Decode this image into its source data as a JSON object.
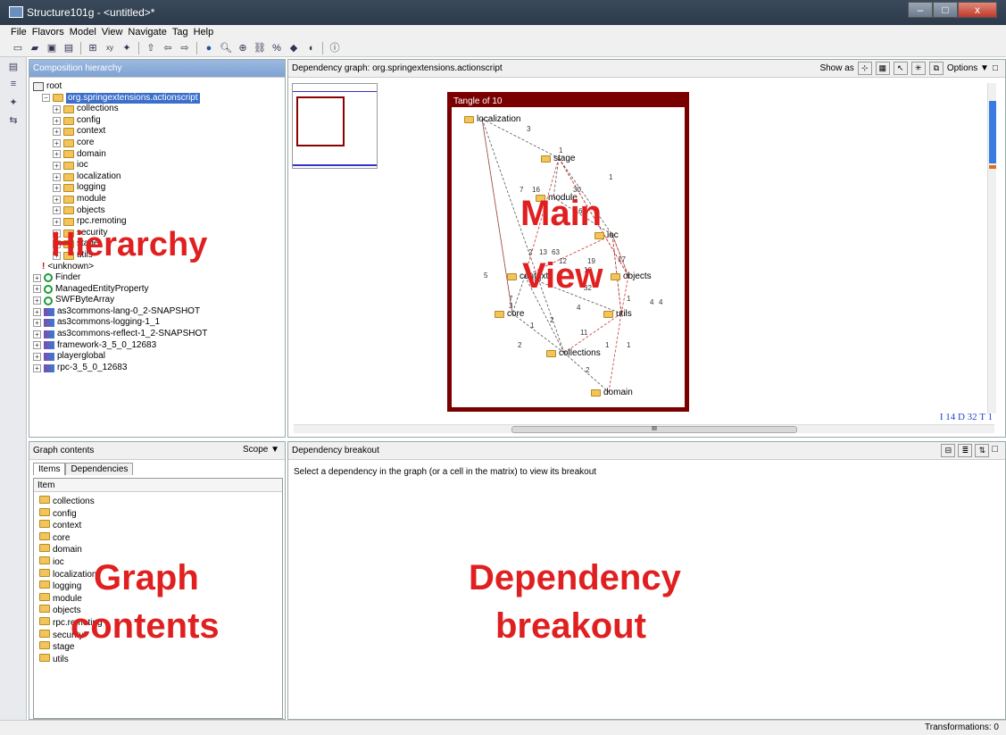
{
  "window": {
    "title": "Structure101g - <untitled>*"
  },
  "menu": [
    "File",
    "Flavors",
    "Model",
    "View",
    "Navigate",
    "Tag",
    "Help"
  ],
  "toolbar_icons": [
    "new-file-icon",
    "open-folder-icon",
    "save-icon",
    "save-as-icon",
    "hierarchy-icon",
    "xy-icon",
    "filter-icon",
    "up-arrow-icon",
    "back-arrow-icon",
    "forward-arrow-icon",
    "dot-icon",
    "zoom-icon",
    "zoom-x-icon",
    "link-icon",
    "percent-icon",
    "tag-icon",
    "bookmark-icon",
    "help-icon"
  ],
  "hierarchy": {
    "title": "Composition hierarchy",
    "items": [
      {
        "label": "root",
        "level": 0,
        "icon": "root"
      },
      {
        "label": "org.springextensions.actionscript",
        "level": 1,
        "icon": "folder",
        "selected": true
      },
      {
        "label": "collections",
        "level": 2,
        "icon": "folder"
      },
      {
        "label": "config",
        "level": 2,
        "icon": "folder"
      },
      {
        "label": "context",
        "level": 2,
        "icon": "folder"
      },
      {
        "label": "core",
        "level": 2,
        "icon": "folder"
      },
      {
        "label": "domain",
        "level": 2,
        "icon": "folder"
      },
      {
        "label": "ioc",
        "level": 2,
        "icon": "folder"
      },
      {
        "label": "localization",
        "level": 2,
        "icon": "folder"
      },
      {
        "label": "logging",
        "level": 2,
        "icon": "folder"
      },
      {
        "label": "module",
        "level": 2,
        "icon": "folder"
      },
      {
        "label": "objects",
        "level": 2,
        "icon": "folder"
      },
      {
        "label": "rpc.remoting",
        "level": 2,
        "icon": "folder"
      },
      {
        "label": "security",
        "level": 2,
        "icon": "folder"
      },
      {
        "label": "stage",
        "level": 2,
        "icon": "folder"
      },
      {
        "label": "utils",
        "level": 2,
        "icon": "folder"
      },
      {
        "label": "<unknown>",
        "level": 1,
        "icon": "unknown"
      },
      {
        "label": "Finder",
        "level": 0,
        "icon": "class"
      },
      {
        "label": "ManagedEntityProperty",
        "level": 0,
        "icon": "class"
      },
      {
        "label": "SWFByteArray",
        "level": 0,
        "icon": "class"
      },
      {
        "label": "as3commons-lang-0_2-SNAPSHOT",
        "level": 0,
        "icon": "jar"
      },
      {
        "label": "as3commons-logging-1_1",
        "level": 0,
        "icon": "jar"
      },
      {
        "label": "as3commons-reflect-1_2-SNAPSHOT",
        "level": 0,
        "icon": "jar"
      },
      {
        "label": "framework-3_5_0_12683",
        "level": 0,
        "icon": "jar"
      },
      {
        "label": "playerglobal",
        "level": 0,
        "icon": "jar"
      },
      {
        "label": "rpc-3_5_0_12683",
        "level": 0,
        "icon": "jar"
      }
    ]
  },
  "main": {
    "title": "Dependency graph: org.springextensions.actionscript",
    "show_as_label": "Show as",
    "options_label": "Options ▼",
    "tangle_title": "Tangle of 10",
    "counts": "I 14 D 32 T 1",
    "nodes": [
      {
        "name": "localization"
      },
      {
        "name": "stage"
      },
      {
        "name": "module"
      },
      {
        "name": "ioc"
      },
      {
        "name": "context"
      },
      {
        "name": "objects"
      },
      {
        "name": "core"
      },
      {
        "name": "utils"
      },
      {
        "name": "collections"
      },
      {
        "name": "domain"
      }
    ],
    "edge_labels": [
      "3",
      "1",
      "7",
      "16",
      "30",
      "6",
      "1",
      "5",
      "2",
      "13",
      "63",
      "12",
      "19",
      "10",
      "17",
      "3",
      "32",
      "4",
      "7",
      "3",
      "4",
      "4",
      "1",
      "1",
      "2",
      "11",
      "1",
      "1",
      "2",
      "2"
    ]
  },
  "graph_contents": {
    "title": "Graph contents",
    "scope_label": "Scope ▼",
    "tabs": [
      "Items",
      "Dependencies"
    ],
    "column": "Item",
    "items": [
      "collections",
      "config",
      "context",
      "core",
      "domain",
      "ioc",
      "localization",
      "logging",
      "module",
      "objects",
      "rpc.remoting",
      "security",
      "stage",
      "utils"
    ]
  },
  "breakout": {
    "title": "Dependency breakout",
    "message": "Select a dependency in the graph (or a cell in the matrix) to view its breakout"
  },
  "overlays": {
    "hierarchy": "Hierarchy",
    "main_view_1": "Main",
    "main_view_2": "View",
    "graph_contents_1": "Graph",
    "graph_contents_2": "contents",
    "dependency_1": "Dependency",
    "dependency_2": "breakout"
  },
  "status": {
    "transformations": "Transformations:  0"
  },
  "colors": {
    "tangle": "#7a0000",
    "overlay": "#e02020",
    "selection": "#3b6fcb"
  }
}
